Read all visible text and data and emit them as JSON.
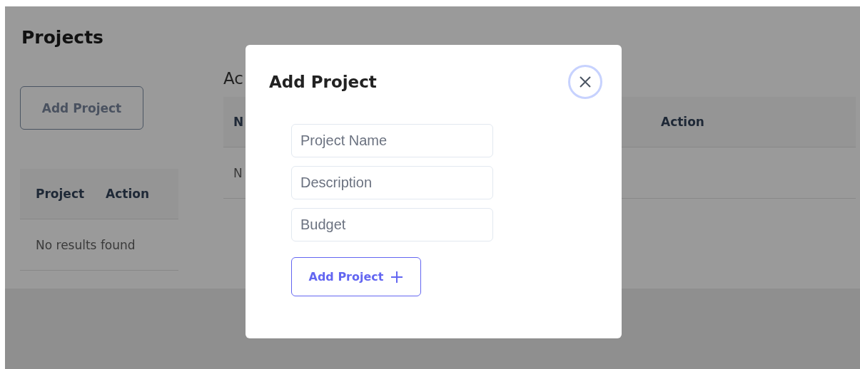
{
  "page": {
    "title": "Projects",
    "add_button": "Add Project",
    "projects_table": {
      "columns": [
        "Project",
        "Action"
      ],
      "empty_message": "No results found"
    },
    "section_heading": "Ac",
    "main_table": {
      "columns": [
        "N",
        "Action"
      ],
      "rows": [
        [
          "N"
        ]
      ]
    }
  },
  "modal": {
    "title": "Add Project",
    "fields": [
      {
        "placeholder": "Project Name"
      },
      {
        "placeholder": "Description"
      },
      {
        "placeholder": "Budget"
      }
    ],
    "submit_button": "Add Project"
  }
}
